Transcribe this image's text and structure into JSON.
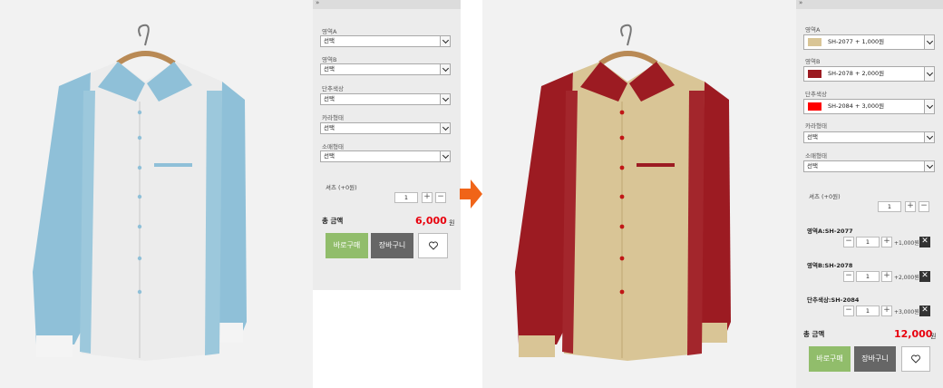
{
  "left": {
    "panel_header": "»",
    "options": [
      {
        "label": "영역A",
        "value": "선택"
      },
      {
        "label": "영역B",
        "value": "선택"
      },
      {
        "label": "단추색상",
        "value": "선택"
      },
      {
        "label": "카라형태",
        "value": "선택"
      },
      {
        "label": "소매형태",
        "value": "선택"
      }
    ],
    "size": {
      "label": "셔츠 (+0원)",
      "qty": "1",
      "plus": "+",
      "minus": "−"
    },
    "total": {
      "label": "총 금액",
      "value": "6,000",
      "unit": "원"
    },
    "buy_label": "바로구매",
    "cart_label": "장바구니"
  },
  "right": {
    "panel_header": "»",
    "color_options": [
      {
        "label": "영역A",
        "value": "SH-2077  + 1,000원",
        "swatch": "#d9c596"
      },
      {
        "label": "영역B",
        "value": "SH-2078  + 2,000원",
        "swatch": "#9c1b22"
      },
      {
        "label": "단추색상",
        "value": "SH-2084  + 3,000원",
        "swatch": "#ff0000"
      }
    ],
    "options": [
      {
        "label": "카라형태",
        "value": "선택"
      },
      {
        "label": "소매형태",
        "value": "선택"
      }
    ],
    "size": {
      "label": "셔츠 (+0원)",
      "qty": "1",
      "plus": "+",
      "minus": "−"
    },
    "selected": [
      {
        "name": "영역A:SH-2077",
        "qty": "1",
        "price": "+1,000원"
      },
      {
        "name": "영역B:SH-2078",
        "qty": "1",
        "price": "+2,000원"
      },
      {
        "name": "단추색상:SH-2084",
        "qty": "1",
        "price": "+3,000원"
      }
    ],
    "selected_controls": {
      "plus": "+",
      "minus": "−",
      "remove": "✕"
    },
    "total": {
      "label": "총 금액",
      "value": "12,000",
      "unit": "원"
    },
    "buy_label": "바로구매",
    "cart_label": "장바구니"
  },
  "colors": {
    "accent_orange": "#f06418",
    "buy_green": "#91bd6b",
    "cart_gray": "#666666",
    "price_red": "#e8000d",
    "shirt_body_before": "#ececec",
    "shirt_sleeve_before": "#8fc0d8",
    "shirt_body_after": "#d9c596",
    "shirt_sleeve_after": "#9c1b22"
  }
}
